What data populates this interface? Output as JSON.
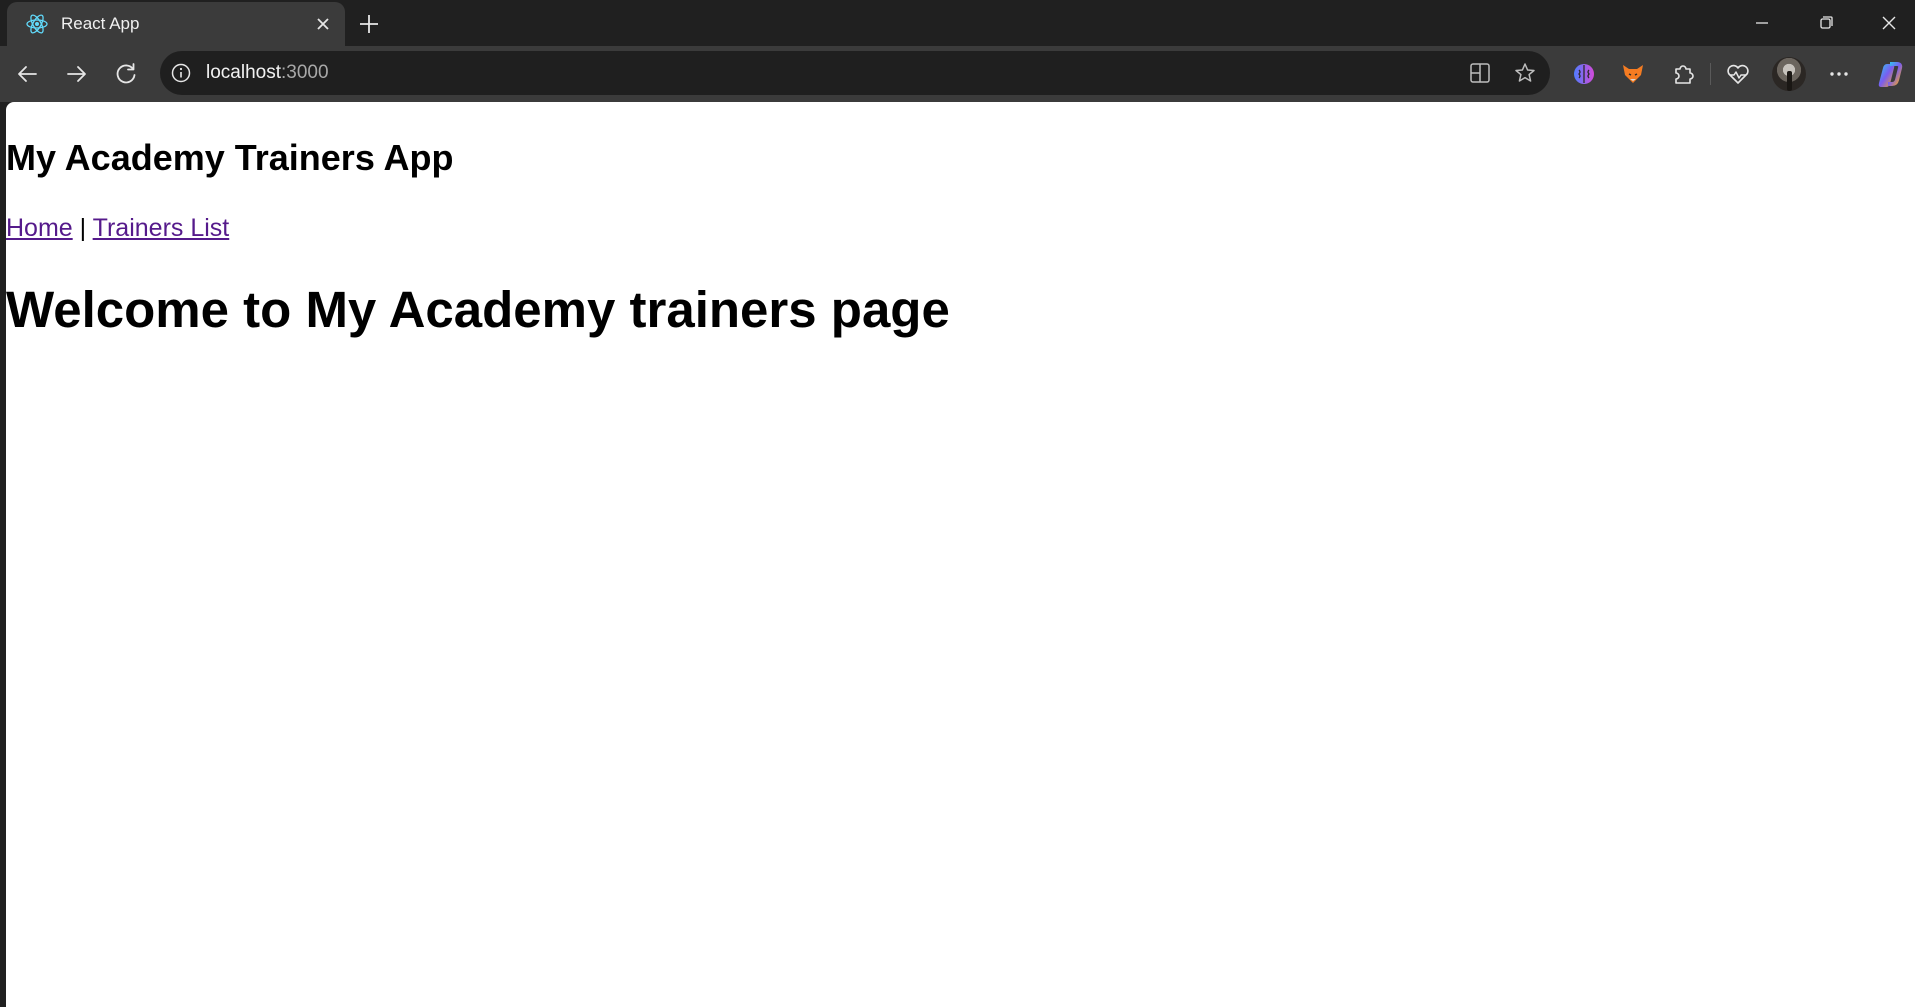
{
  "browser": {
    "tab": {
      "title": "React App",
      "favicon": "react-logo-icon"
    },
    "address_bar": {
      "host": "localhost",
      "port": ":3000"
    },
    "toolbar_icons": [
      "back-icon",
      "forward-icon",
      "reload-icon",
      "site-info-icon",
      "split-screen-icon",
      "favorite-star-icon",
      "brain-extension-icon",
      "fox-extension-icon",
      "extensions-icon",
      "browser-essentials-icon",
      "profile-avatar",
      "more-icon",
      "copilot-icon"
    ]
  },
  "page": {
    "app_title": "My Academy Trainers App",
    "nav": {
      "home": "Home",
      "separator": "|",
      "trainers_list": "Trainers List"
    },
    "welcome": "Welcome to My Academy trainers page"
  },
  "colors": {
    "link": "#551a8b",
    "chrome_dark": "#202020",
    "chrome_tab": "#3b3b3b",
    "react_blue": "#61dafb"
  }
}
